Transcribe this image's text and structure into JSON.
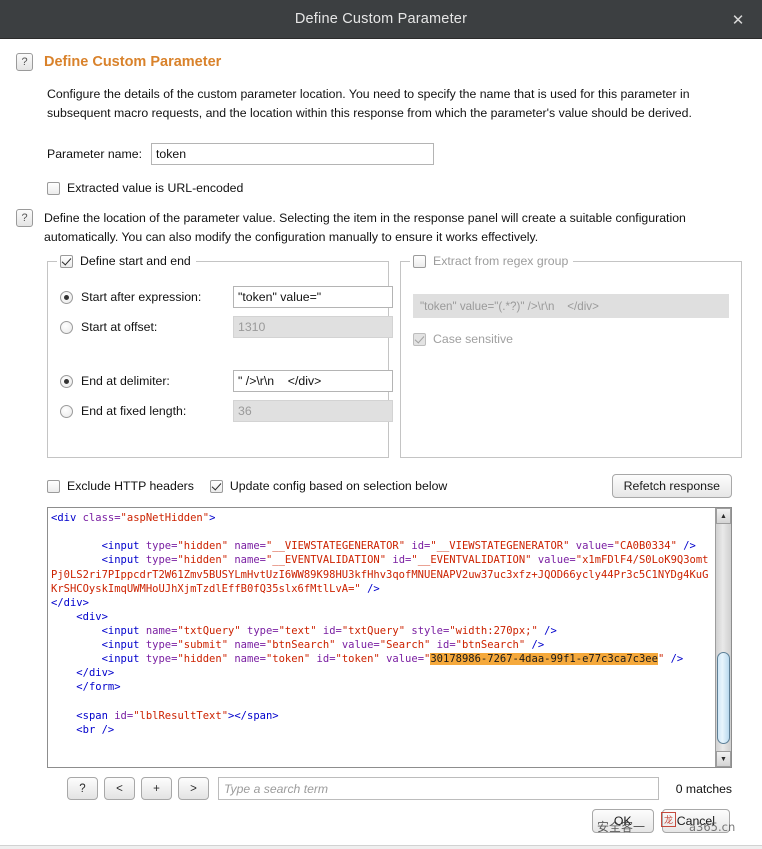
{
  "window": {
    "title": "Define Custom Parameter",
    "close_icon": "close-icon",
    "close_glyph": "✕"
  },
  "section": {
    "help_glyph": "?",
    "heading": "Define Custom Parameter",
    "description": "Configure the details of the custom parameter location. You need to specify the name that is used for this parameter in subsequent macro requests, and the location within this response from which the parameter's value should be derived."
  },
  "parameter": {
    "name_label": "Parameter name:",
    "name_value": "token",
    "url_encoded_label": "Extracted value is URL-encoded",
    "url_encoded_checked": false
  },
  "location": {
    "help_glyph": "?",
    "description": "Define the location of the parameter value. Selecting the item in the response panel will create a suitable configuration automatically. You can also modify the configuration manually to ensure it works effectively."
  },
  "start_end_group": {
    "legend": "Define start and end",
    "enabled": true,
    "options": [
      {
        "label": "Start after expression:",
        "selected": true,
        "value": "\"token\" value=\"",
        "readonly": false
      },
      {
        "label": "Start at offset:",
        "selected": false,
        "value": "1310",
        "readonly": true
      },
      {
        "label": "End at delimiter:",
        "selected": true,
        "value": "\" />\\r\\n    </div>",
        "readonly": false
      },
      {
        "label": "End at fixed length:",
        "selected": false,
        "value": "36",
        "readonly": true
      }
    ]
  },
  "regex_group": {
    "legend": "Extract from regex group",
    "enabled": false,
    "pattern": "\"token\" value=\"(.*?)\" />\\r\\n    </div>",
    "case_sensitive_label": "Case sensitive",
    "case_sensitive_checked": true
  },
  "mid_controls": {
    "exclude_headers_label": "Exclude HTTP headers",
    "exclude_headers_checked": false,
    "update_config_label": "Update config based on selection below",
    "update_config_checked": true,
    "refetch_label": "Refetch response"
  },
  "response_code": {
    "lines": [
      {
        "parts": [
          {
            "t": "<div ",
            "c": "tag"
          },
          {
            "t": "class=",
            "c": "attr"
          },
          {
            "t": "\"aspNetHidden\"",
            "c": "val"
          },
          {
            "t": ">",
            "c": "tag"
          }
        ]
      },
      {
        "parts": [
          {
            "t": "",
            "c": "pln"
          }
        ]
      },
      {
        "parts": [
          {
            "t": "        <input ",
            "c": "tag"
          },
          {
            "t": "type=",
            "c": "attr"
          },
          {
            "t": "\"hidden\" ",
            "c": "val"
          },
          {
            "t": "name=",
            "c": "attr"
          },
          {
            "t": "\"__VIEWSTATEGENERATOR\" ",
            "c": "val"
          },
          {
            "t": "id=",
            "c": "attr"
          },
          {
            "t": "\"__VIEWSTATEGENERATOR\" ",
            "c": "val"
          },
          {
            "t": "value=",
            "c": "attr"
          },
          {
            "t": "\"CA0B0334\" ",
            "c": "val"
          },
          {
            "t": "/>",
            "c": "tag"
          }
        ]
      },
      {
        "parts": [
          {
            "t": "        <input ",
            "c": "tag"
          },
          {
            "t": "type=",
            "c": "attr"
          },
          {
            "t": "\"hidden\" ",
            "c": "val"
          },
          {
            "t": "name=",
            "c": "attr"
          },
          {
            "t": "\"__EVENTVALIDATION\" ",
            "c": "val"
          },
          {
            "t": "id=",
            "c": "attr"
          },
          {
            "t": "\"__EVENTVALIDATION\" ",
            "c": "val"
          },
          {
            "t": "value=",
            "c": "attr"
          },
          {
            "t": "\"x1mFDlF4/S0LoK9Q3omtPj0LS2ri7PIppcdrT2W61Zmv5BUSYLmHvtUzI6WW89K98HU3kfHhv3qofMNUENAPV2uw37uc3xfz+JQOD66ycly44Pr3c5C1NYDg4KuGKrSHCOyskImqUWMHoUJhXjmTzdlEffB0fQ35slx6fMtlLvA=\" ",
            "c": "val"
          },
          {
            "t": "/>",
            "c": "tag"
          }
        ]
      },
      {
        "parts": [
          {
            "t": "</div>",
            "c": "tag"
          }
        ]
      },
      {
        "parts": [
          {
            "t": "    <div>",
            "c": "tag"
          }
        ]
      },
      {
        "parts": [
          {
            "t": "        <input ",
            "c": "tag"
          },
          {
            "t": "name=",
            "c": "attr"
          },
          {
            "t": "\"txtQuery\" ",
            "c": "val"
          },
          {
            "t": "type=",
            "c": "attr"
          },
          {
            "t": "\"text\" ",
            "c": "val"
          },
          {
            "t": "id=",
            "c": "attr"
          },
          {
            "t": "\"txtQuery\" ",
            "c": "val"
          },
          {
            "t": "style=",
            "c": "attr"
          },
          {
            "t": "\"width:270px;\" ",
            "c": "val"
          },
          {
            "t": "/>",
            "c": "tag"
          }
        ]
      },
      {
        "parts": [
          {
            "t": "        <input ",
            "c": "tag"
          },
          {
            "t": "type=",
            "c": "attr"
          },
          {
            "t": "\"submit\" ",
            "c": "val"
          },
          {
            "t": "name=",
            "c": "attr"
          },
          {
            "t": "\"btnSearch\" ",
            "c": "val"
          },
          {
            "t": "value=",
            "c": "attr"
          },
          {
            "t": "\"Search\" ",
            "c": "val"
          },
          {
            "t": "id=",
            "c": "attr"
          },
          {
            "t": "\"btnSearch\" ",
            "c": "val"
          },
          {
            "t": "/>",
            "c": "tag"
          }
        ]
      },
      {
        "parts": [
          {
            "t": "        <input ",
            "c": "tag"
          },
          {
            "t": "type=",
            "c": "attr"
          },
          {
            "t": "\"hidden\" ",
            "c": "val"
          },
          {
            "t": "name=",
            "c": "attr"
          },
          {
            "t": "\"token\" ",
            "c": "val"
          },
          {
            "t": "id=",
            "c": "attr"
          },
          {
            "t": "\"token\" ",
            "c": "val"
          },
          {
            "t": "value=",
            "c": "attr"
          },
          {
            "t": "\"",
            "c": "val"
          },
          {
            "t": "30178986-7267-4daa-99f1-e77c3ca7c3ee",
            "c": "hl"
          },
          {
            "t": "\" ",
            "c": "val"
          },
          {
            "t": "/>",
            "c": "tag"
          }
        ]
      },
      {
        "parts": [
          {
            "t": "    </div>",
            "c": "tag"
          }
        ]
      },
      {
        "parts": [
          {
            "t": "    </form>",
            "c": "tag"
          }
        ]
      },
      {
        "parts": [
          {
            "t": "",
            "c": "pln"
          }
        ]
      },
      {
        "parts": [
          {
            "t": "    <span ",
            "c": "tag"
          },
          {
            "t": "id=",
            "c": "attr"
          },
          {
            "t": "\"lblResultText\"",
            "c": "val"
          },
          {
            "t": "></span>",
            "c": "tag"
          }
        ]
      },
      {
        "parts": [
          {
            "t": "    <br />",
            "c": "tag"
          }
        ]
      }
    ],
    "highlight_token": "30178986-7267-4daa-99f1-e77c3ca7c3ee",
    "scroll_up_glyph": "▲",
    "scroll_down_glyph": "▼"
  },
  "search": {
    "help_label": "?",
    "prev_label": "<",
    "add_label": "+",
    "next_label": ">",
    "placeholder": "Type a search term",
    "value": "",
    "matches": "0 matches"
  },
  "footer": {
    "ok_label": "OK",
    "cancel_label": "Cancel"
  },
  "watermark": {
    "left_text": "安全客一",
    "seal_text": "龙",
    "right_text": "a365.cn"
  },
  "colors": {
    "titlebar_bg": "#3c3f41",
    "heading_orange": "#d9822b",
    "highlight_orange": "#f5a93c",
    "tag_blue": "#0000cc",
    "attr_purple": "#7a1fa2",
    "value_red": "#cc2200",
    "scrollbar_thumb": "#cfe6f5"
  }
}
